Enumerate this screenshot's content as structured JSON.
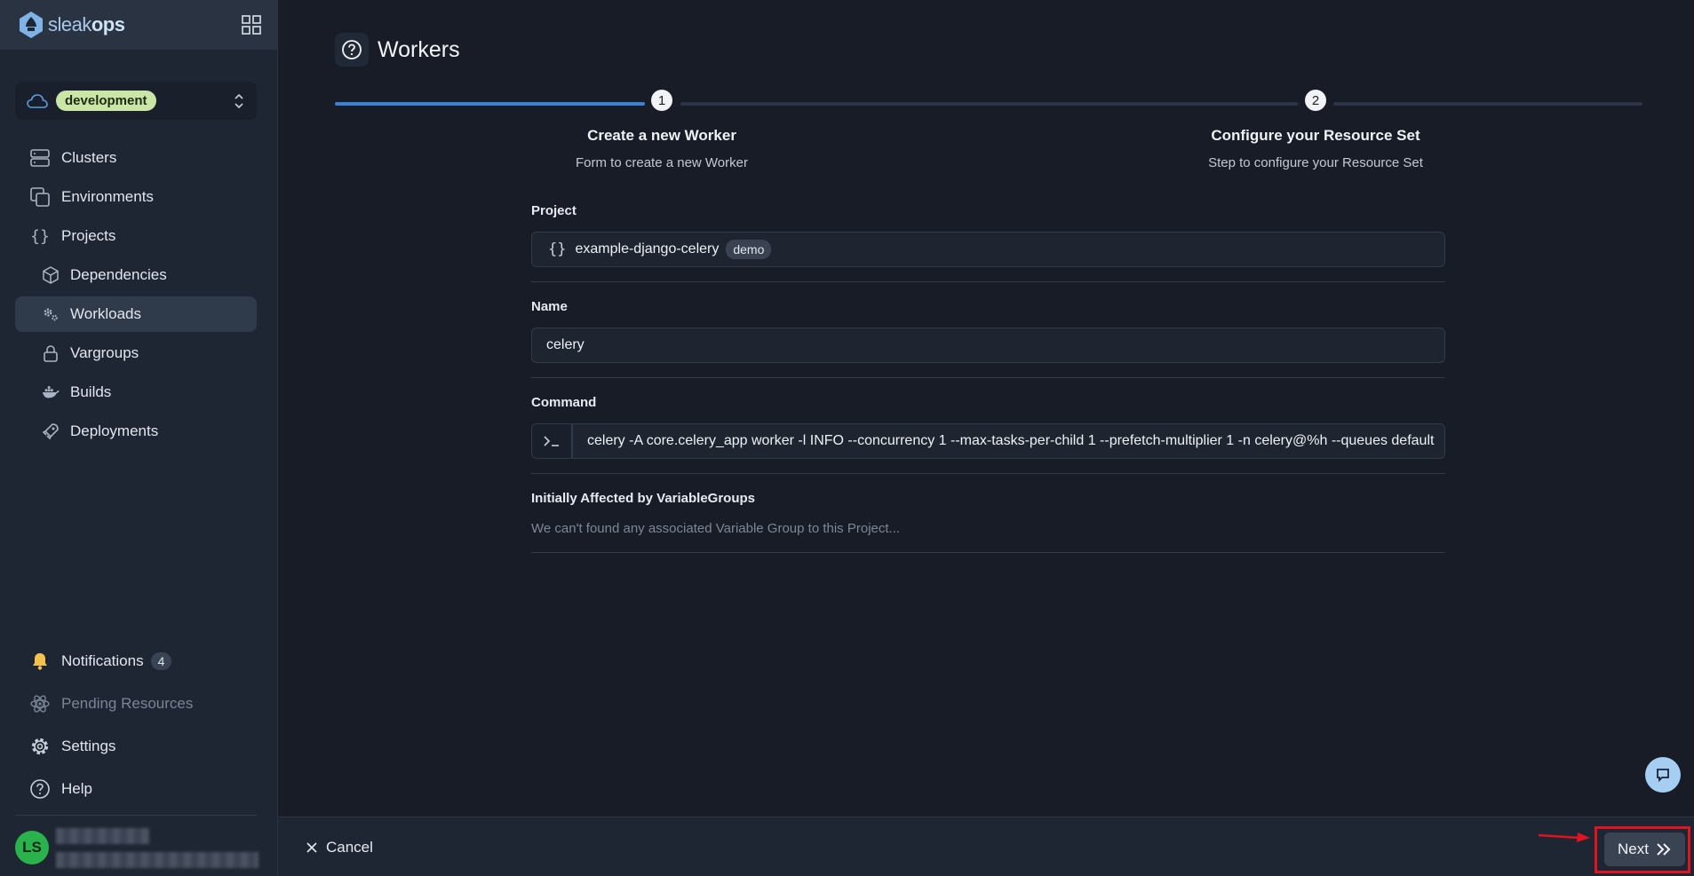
{
  "brand": {
    "logo_text_a": "sleak",
    "logo_text_b": "ops"
  },
  "env": {
    "selected": "development"
  },
  "nav": {
    "clusters": "Clusters",
    "environments": "Environments",
    "projects": "Projects",
    "dependencies": "Dependencies",
    "workloads": "Workloads",
    "vargroups": "Vargroups",
    "builds": "Builds",
    "deployments": "Deployments",
    "notifications": "Notifications",
    "notifications_count": "4",
    "pending": "Pending Resources",
    "settings": "Settings",
    "help": "Help"
  },
  "user": {
    "initials": "LS"
  },
  "page": {
    "title": "Workers"
  },
  "steps": [
    {
      "number": "1",
      "title": "Create a new Worker",
      "subtitle": "Form to create a new Worker"
    },
    {
      "number": "2",
      "title": "Configure your Resource Set",
      "subtitle": "Step to configure your Resource Set"
    }
  ],
  "form": {
    "project_label": "Project",
    "project_value": "example-django-celery",
    "project_badge": "demo",
    "name_label": "Name",
    "name_value": "celery",
    "command_label": "Command",
    "command_value": "celery -A core.celery_app worker -l INFO --concurrency 1 --max-tasks-per-child 1 --prefetch-multiplier 1 -n celery@%h --queues default",
    "vargroups_label": "Initially Affected by VariableGroups",
    "vargroups_empty": "We can't found any associated Variable Group to this Project..."
  },
  "footer": {
    "cancel": "Cancel",
    "next": "Next"
  },
  "colors": {
    "accent": "#3b82d6",
    "highlight": "#e0141e",
    "env_badge": "#c9e6a7",
    "avatar": "#2bb24c"
  }
}
